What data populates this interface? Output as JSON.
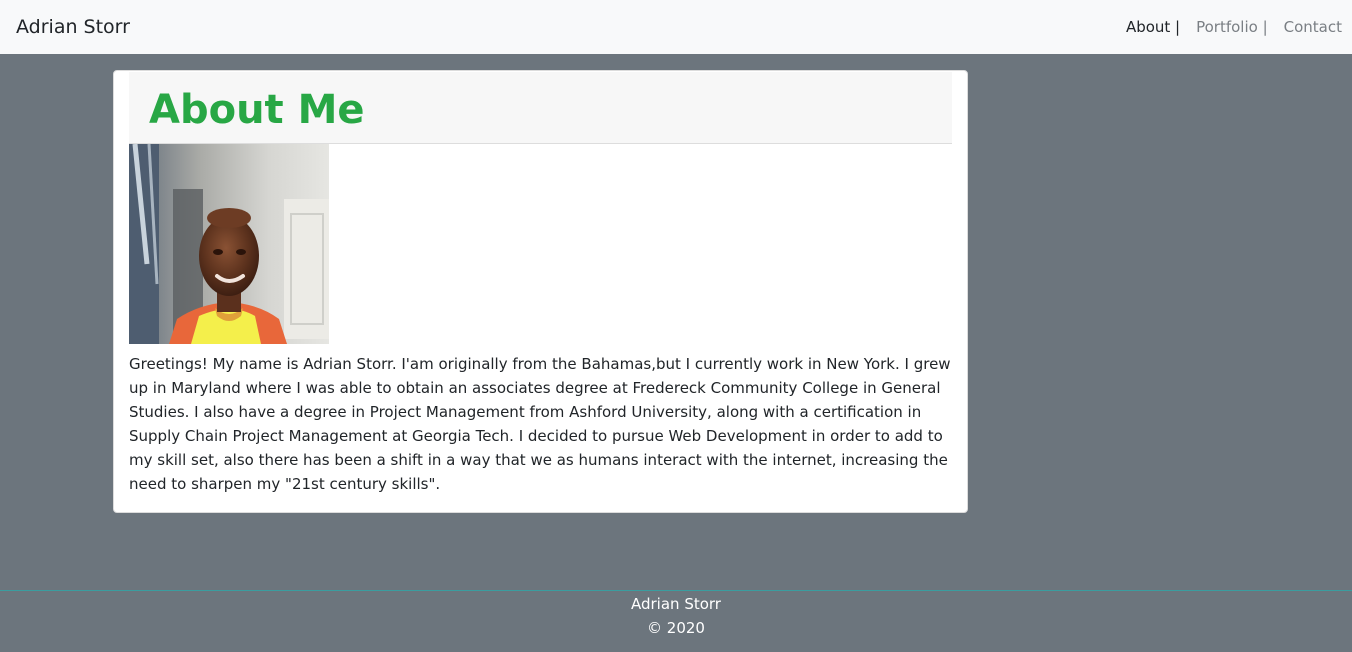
{
  "navbar": {
    "brand": "Adrian Storr",
    "links": [
      {
        "label": "About |"
      },
      {
        "label": "Portfolio |"
      },
      {
        "label": "Contact"
      }
    ]
  },
  "about": {
    "title": "About Me",
    "bio": "Greetings! My name is Adrian Storr. I'am originally from the Bahamas,but I currently work in New York. I grew up in Maryland where I was able to obtain an associates degree at Fredereck Community College in General Studies. I also have a degree in Project Management from Ashford University, along with a certification in Supply Chain Project Management at Georgia Tech. I decided to pursue Web Development in order to add to my skill set, also there has been a shift in a way that we as humans interact with the internet, increasing the need to sharpen my \"21st century skills\"."
  },
  "footer": {
    "name": "Adrian Storr",
    "copyright": "© 2020"
  },
  "colors": {
    "page_background": "#6c757d",
    "navbar_background": "#f8f9fa",
    "title_green": "#28a745"
  }
}
